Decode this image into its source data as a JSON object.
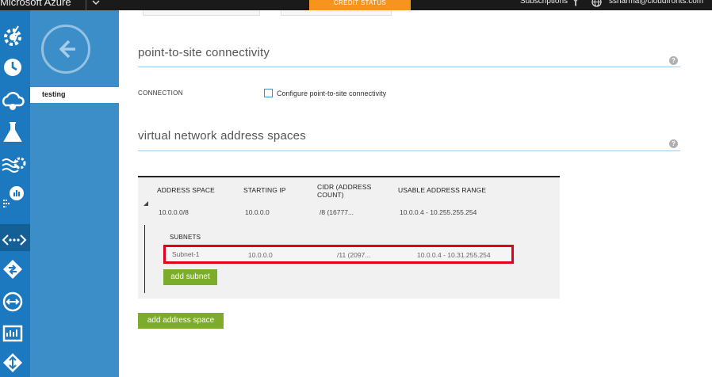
{
  "topbar": {
    "brand": "Microsoft Azure",
    "credit_status": "CREDIT STATUS",
    "subscriptions": "Subscriptions",
    "user_email": "ssharma@cloudfronts.com",
    "credit_color": "#f7941d"
  },
  "rail": {
    "icons": [
      "gear-bolt-icon",
      "clock-icon",
      "cloud-gear-icon",
      "flask-icon",
      "waves-gear-icon",
      "chart-icon",
      "virtual-network-icon",
      "traffic-manager-icon",
      "vpn-gateway-icon",
      "dashboard-icon",
      "diamond-arrows-icon"
    ],
    "accent": "#1c79c0"
  },
  "sidebar": {
    "items": [
      {
        "label": "testing"
      }
    ]
  },
  "p2s": {
    "title": "point-to-site connectivity",
    "connection_label": "CONNECTION",
    "checkbox_label": "Configure point-to-site connectivity",
    "checked": false
  },
  "vnet": {
    "title": "virtual network address spaces",
    "columns": [
      "ADDRESS SPACE",
      "STARTING IP",
      "CIDR (ADDRESS COUNT)",
      "USABLE ADDRESS RANGE"
    ],
    "rows": [
      {
        "address_space": "10.0.0.0/8",
        "starting_ip": "10.0.0.0",
        "cidr": "/8 (16777...",
        "usable_range": "10.0.0.4 - 10.255.255.254"
      }
    ],
    "subnets_label": "SUBNETS",
    "subnets": [
      {
        "name": "Subnet-1",
        "starting_ip": "10.0.0.0",
        "cidr": "/11 (2097...",
        "usable_range": "10.0.0.4 - 10.31.255.254"
      }
    ],
    "add_subnet_label": "add subnet",
    "add_address_space_label": "add address space",
    "button_color": "#7dac2a",
    "highlight_color": "#e3001b"
  }
}
